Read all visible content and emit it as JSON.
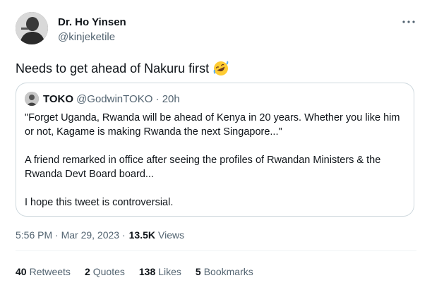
{
  "author": {
    "name": "Dr. Ho Yinsen",
    "handle": "@kinjeketile"
  },
  "tweet": {
    "text": "Needs to get ahead of Nakuru first",
    "emoji": "rolling-on-floor-laughing-icon"
  },
  "quote": {
    "name": "TOKO",
    "meta": "@GodwinTOKO · 20h",
    "paragraphs": [
      "\"Forget Uganda, Rwanda will be ahead of Kenya in 20 years. Whether you like him or not, Kagame is making Rwanda the next Singapore...\"",
      "A friend remarked in office after seeing the profiles of Rwandan Ministers & the Rwanda Devt Board board...",
      "I hope this tweet is controversial."
    ]
  },
  "meta": {
    "timestamp": "5:56 PM · Mar 29, 2023 ·",
    "views_count": "13.5K",
    "views_label": "Views"
  },
  "stats": [
    {
      "num": "40",
      "label": "Retweets"
    },
    {
      "num": "2",
      "label": "Quotes"
    },
    {
      "num": "138",
      "label": "Likes"
    },
    {
      "num": "5",
      "label": "Bookmarks"
    }
  ],
  "colors": {
    "text": "#0f1419",
    "secondary": "#536471",
    "border": "#cfd9de"
  }
}
